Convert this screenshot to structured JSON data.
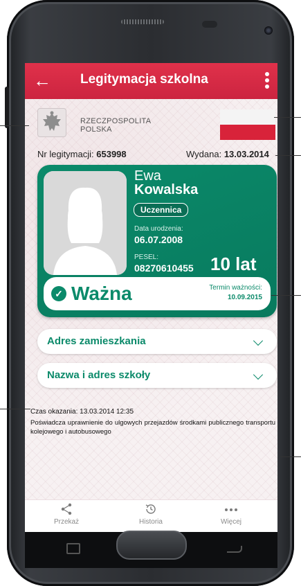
{
  "appbar": {
    "title": "Legitymacja szkolna",
    "back": "←"
  },
  "header": {
    "country_line1": "RZECZPOSPOLITA",
    "country_line2": "POLSKA"
  },
  "meta": {
    "nr_label": "Nr legitymacji:",
    "nr_value": "653998",
    "issued_label": "Wydana:",
    "issued_value": "13.03.2014"
  },
  "card": {
    "first_name": "Ewa",
    "last_name": "Kowalska",
    "role": "Uczennica",
    "dob_label": "Data urodzenia:",
    "dob_value": "06.07.2008",
    "pesel_label": "PESEL:",
    "pesel_value": "08270610455",
    "age": "10 lat",
    "status": "Ważna",
    "validity_label": "Termin ważności:",
    "validity_value": "10.09.2015",
    "accent_color": "#0b8a6a"
  },
  "sections": [
    {
      "label": "Adres zamieszkania"
    },
    {
      "label": "Nazwa i adres szkoły"
    }
  ],
  "footer": {
    "shown_time": "Czas okazania: 13.03.2014 12:35",
    "description": "Poświadcza uprawnienie do ulgowych przejazdów środkami publicznego transportu kolejowego i autobusowego"
  },
  "bottom_nav": [
    {
      "label": "Przekaż",
      "icon": "share-icon"
    },
    {
      "label": "Historia",
      "icon": "history-icon"
    },
    {
      "label": "Więcej",
      "icon": "more-dots-icon"
    }
  ],
  "colors": {
    "appbar": "#d32a44",
    "card": "#0b8a6a",
    "flag_red": "#d8233a"
  }
}
